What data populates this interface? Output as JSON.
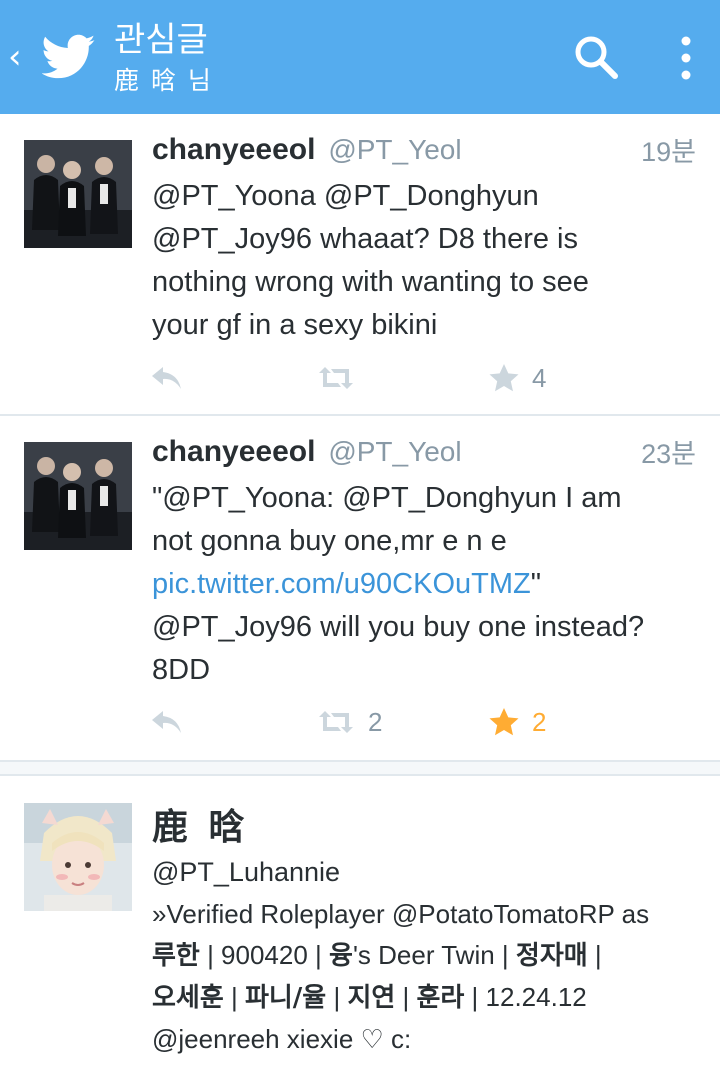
{
  "appbar": {
    "title": "관심글",
    "subtitle": "鹿 晗 님",
    "color": "#55acee",
    "icons": [
      "chevron-left-icon",
      "twitter-bird-icon",
      "search-icon",
      "more-vertical-icon"
    ]
  },
  "tweets": [
    {
      "display_name": "chanyeeeol",
      "handle": "@PT_Yeol",
      "time": "19분",
      "text": [
        "@PT_Yoona @PT_Donghyun",
        "@PT_Joy96 whaaat? D8 there is",
        "nothing wrong with wanting to see",
        "your gf in a sexy bikini"
      ],
      "retweets": "",
      "favorites": "4",
      "favorited": false
    },
    {
      "display_name": "chanyeeeol",
      "handle": "@PT_Yeol",
      "time": "23분",
      "text_line1": "\"@PT_Yoona: @PT_Donghyun I am",
      "text_line2": "not gonna buy one,mr e n e",
      "text_link": "pic.twitter.com/u90CKOuTMZ",
      "text_link_tail": "\"",
      "text_line4": "@PT_Joy96 will you buy one instead?",
      "text_line5": "8DD",
      "retweets": "2",
      "favorites": "2",
      "favorited": true
    }
  ],
  "profile": {
    "name": "鹿 晗",
    "handle": "@PT_Luhannie",
    "bio": {
      "l1": "»Verified Roleplayer @PotatoTomatoRP as",
      "l2_b1": "루한",
      "l2_t1": " | 900420 | ",
      "l2_b2": "융",
      "l2_t2": "'s Deer Twin | ",
      "l2_b3": "정자매",
      "l2_t3": " |",
      "l3_b1": "오세훈",
      "l3_t1": " | ",
      "l3_b2": "파니/율",
      "l3_t2": " | ",
      "l3_b3": "지연",
      "l3_t3": " | ",
      "l3_b4": "훈라",
      "l3_t4": " | 12.24.12",
      "l4": "@jeenreeh xiexie ♡ c:"
    }
  },
  "colors": {
    "link": "#3b94d9",
    "muted": "#8899a6",
    "favorite_active": "#ffac33",
    "divider": "#e1e8ed"
  }
}
